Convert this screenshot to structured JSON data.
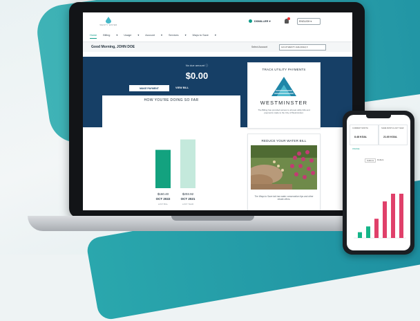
{
  "header": {
    "logo_text": "WESTY WATER",
    "user_name": "DSMILLER",
    "language": "ENGLISH"
  },
  "nav": {
    "items": [
      "Home",
      "Billing",
      "Usage",
      "Account",
      "Services",
      "Ways to Save"
    ]
  },
  "greeting": "Good Morning, JOHN DOE",
  "account_select": {
    "label": "Select Account",
    "value": "123 W WESTY AVE (0012)"
  },
  "billing": {
    "due_label": "No due amount",
    "amount": "$0.00",
    "make_payment": "MAKE PAYMENT",
    "view_bill": "VIEW BILL"
  },
  "chart_section_title": "HOW YOU'RE DOING SO FAR",
  "chart_data": {
    "type": "bar",
    "categories": [
      "OCT 2022",
      "OCT 2021"
    ],
    "values": [
      160.4,
      203.92
    ],
    "value_labels": [
      "$160.40",
      "$203.92"
    ],
    "sub_labels": [
      "LAST BILL",
      "LAST YEAR"
    ],
    "colors": [
      "#13a27f",
      "#c4e9dc"
    ],
    "ylim": [
      0,
      220
    ],
    "grid": false
  },
  "track_panel": {
    "title": "TRACK UTILITY PAYMENTS",
    "brand": "WESTMINSTER",
    "text": "The Billing has provided access to all past utility bills and payments made to the City of Westminster."
  },
  "reduce_panel": {
    "title": "REDUCE YOUR WATER BILL",
    "text": "The Ways to Save tab has water conservation tips and other rebate offers."
  },
  "phone": {
    "box1_label": "CURRENT MONTH",
    "box1_value": "8.48 KGAL",
    "box2_label": "SAME MONTH LAST YEAR",
    "box2_value": "21.60 KGAL",
    "section_label": "USAGE",
    "toggle_a": "Gallons",
    "toggle_b": "Dollars",
    "chart_values": [
      3,
      6,
      10,
      19,
      23,
      23
    ],
    "chart_colors": [
      "#15b589",
      "#15b589",
      "#e0406a",
      "#e0406a",
      "#e0406a",
      "#e0406a"
    ]
  }
}
